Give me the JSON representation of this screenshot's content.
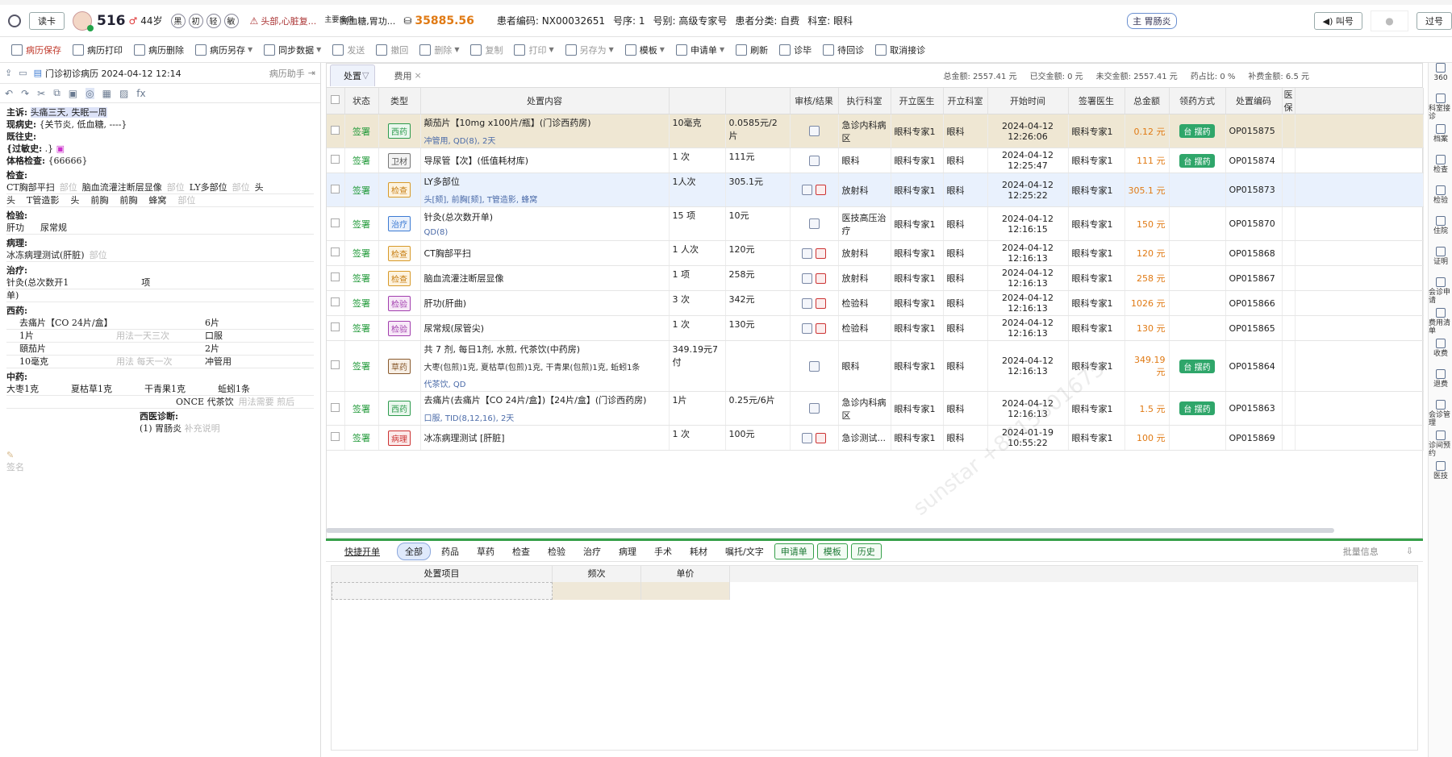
{
  "header": {
    "read_card": "读卡",
    "id_num": "516",
    "age": "44岁",
    "badges": [
      "黑",
      "初",
      "轻",
      "敏"
    ],
    "allergy": "头部,心脏复...",
    "diseases_label": "主要疾病",
    "diseases": "高血糖,胃功...",
    "balance": "35885.56",
    "patient_code": "患者编码: NX00032651",
    "seq": "号序: 1",
    "reg_type": "号别: 高级专家号",
    "category": "患者分类: 自费",
    "dept": "科室: 眼科",
    "diag_tag": "主 胃肠炎",
    "call_btn": "叫号",
    "skip_btn": "过号"
  },
  "toolbar": [
    {
      "label": "病历保存",
      "style": "red"
    },
    {
      "label": "病历打印",
      "style": ""
    },
    {
      "label": "病历删除",
      "style": ""
    },
    {
      "label": "病历另存",
      "style": "",
      "caret": true
    },
    {
      "label": "同步数据",
      "style": "",
      "caret": true
    },
    {
      "label": "发送",
      "style": "dim"
    },
    {
      "label": "撤回",
      "style": "dim"
    },
    {
      "label": "删除",
      "style": "dim",
      "caret": true
    },
    {
      "label": "复制",
      "style": "dim"
    },
    {
      "label": "打印",
      "style": "dim",
      "caret": true
    },
    {
      "label": "另存为",
      "style": "dim",
      "caret": true
    },
    {
      "label": "模板",
      "style": "",
      "caret": true
    },
    {
      "label": "申请单",
      "style": "",
      "caret": true
    },
    {
      "label": "刷新",
      "style": ""
    },
    {
      "label": "诊毕",
      "style": ""
    },
    {
      "label": "待回诊",
      "style": ""
    },
    {
      "label": "取消接诊",
      "style": ""
    }
  ],
  "emr": {
    "title": "门诊初诊病历 2024-04-12 12:14",
    "assistant": "病历助手",
    "chief_label": "主诉:",
    "chief": "头痛三天, 失眠一周",
    "present_label": "现病史:",
    "present": "{关节炎, 低血糖, ----}",
    "past_label": "既往史:",
    "allergy_label": "{过敏史:",
    "allergy_val": ".}",
    "exam_label": "体格检查:",
    "exam": "{66666}",
    "check_label": "检查:",
    "check_items": [
      "CT胸部平扫",
      "部位",
      "脑血流灌注断层显像",
      "部位",
      "LY多部位",
      "部位",
      "头"
    ],
    "check_row2": [
      "头",
      "T管造影",
      "头",
      "前胸",
      "前胸",
      "蜂窝",
      "部位"
    ],
    "lab_label": "检验:",
    "lab_items": [
      "肝功",
      "尿常规"
    ],
    "path_label": "病理:",
    "path_item": "冰冻病理测试(肝脏)",
    "path_part": "部位",
    "treat_label": "治疗:",
    "treat_item": "针灸(总次数开1",
    "treat_unit": "项",
    "treat_tail": "单)",
    "wm_label": "西药:",
    "wm_rows": [
      [
        "去痛片【CO 24片/盒】",
        "",
        "6片"
      ],
      [
        "1片",
        "用法一天三次",
        "口服"
      ],
      [
        "頤茄片",
        "",
        "2片"
      ],
      [
        "10毫克",
        "用法 每天一次",
        "冲管用"
      ]
    ],
    "cm_label": "中药:",
    "cm_items": [
      "大枣1克",
      "夏枯草1克",
      "干青果1克",
      "蚯蚓1条"
    ],
    "cm_usage": "ONCE 代茶饮",
    "cm_usage2": "用法需要 煎后",
    "diag_label": "西医诊断:",
    "diag": "(1) 胃肠炎",
    "diag_note": "补充说明",
    "sign": "签名"
  },
  "main": {
    "tabs": [
      "处置",
      "费用"
    ],
    "totals": [
      "总金额: 2557.41 元",
      "已交金额: 0 元",
      "未交金额: 2557.41 元",
      "药占比: 0 %",
      "补费金额: 6.5 元"
    ],
    "columns": [
      "状态",
      "类型",
      "处置内容",
      "",
      "",
      "审核/结果",
      "执行科室",
      "开立医生",
      "开立科室",
      "开始时间",
      "签署医生",
      "总金额",
      "领药方式",
      "处置编码",
      "医保"
    ],
    "rows": [
      {
        "status": "签署",
        "type": "西药",
        "tag": "t-xy",
        "content": "颠茄片【10mg x100片/瓶】(门诊西药房)",
        "sub": "冲管用, QD(8), 2天",
        "qty": "10毫克",
        "price": "0.0585元/2片",
        "icons": 1,
        "exec": "急诊内科病区",
        "doc": "眼科专家1",
        "dept": "眼科",
        "time": "2024-04-12 12:26:06",
        "sign": "眼科专家1",
        "amt": "0.12 元",
        "pickup": "台 摆药",
        "code": "OP015875",
        "sel": "sel"
      },
      {
        "status": "签署",
        "type": "卫材",
        "tag": "t-wc",
        "content": "导尿管【次】(低值耗材库)",
        "sub": "",
        "qty": "1 次",
        "price": "111元",
        "icons": 1,
        "exec": "眼科",
        "doc": "眼科专家1",
        "dept": "眼科",
        "time": "2024-04-12 12:25:47",
        "sign": "眼科专家1",
        "amt": "111 元",
        "pickup": "台 摆药",
        "code": "OP015874",
        "sel": ""
      },
      {
        "status": "签署",
        "type": "检查",
        "tag": "t-jc",
        "content": "LY多部位",
        "sub": "头[颏], 前胸[颏], T管造影, 蜂窝",
        "qty": "1人次",
        "price": "305.1元",
        "icons": 2,
        "exec": "放射科",
        "doc": "眼科专家1",
        "dept": "眼科",
        "time": "2024-04-12 12:25:22",
        "sign": "眼科专家1",
        "amt": "305.1 元",
        "pickup": "",
        "code": "OP015873",
        "sel": "cur"
      },
      {
        "status": "签署",
        "type": "治疗",
        "tag": "t-zl",
        "content": "针灸(总次数开单)",
        "sub": "QD(8)",
        "qty": "15 项",
        "price": "10元",
        "icons": 1,
        "exec": "医技高压治疗",
        "doc": "眼科专家1",
        "dept": "眼科",
        "time": "2024-04-12 12:16:15",
        "sign": "眼科专家1",
        "amt": "150 元",
        "pickup": "",
        "code": "OP015870",
        "sel": ""
      },
      {
        "status": "签署",
        "type": "检查",
        "tag": "t-jc",
        "content": "CT胸部平扫",
        "sub": "",
        "qty": "1 人次",
        "price": "120元",
        "icons": 2,
        "exec": "放射科",
        "doc": "眼科专家1",
        "dept": "眼科",
        "time": "2024-04-12 12:16:13",
        "sign": "眼科专家1",
        "amt": "120 元",
        "pickup": "",
        "code": "OP015868",
        "sel": ""
      },
      {
        "status": "签署",
        "type": "检查",
        "tag": "t-jc",
        "content": "脑血流灌注断层显像",
        "sub": "",
        "qty": "1 项",
        "price": "258元",
        "icons": 2,
        "exec": "放射科",
        "doc": "眼科专家1",
        "dept": "眼科",
        "time": "2024-04-12 12:16:13",
        "sign": "眼科专家1",
        "amt": "258 元",
        "pickup": "",
        "code": "OP015867",
        "sel": ""
      },
      {
        "status": "签署",
        "type": "检验",
        "tag": "t-jy",
        "content": "肝功(肝曲)",
        "sub": "",
        "qty": "3 次",
        "price": "342元",
        "icons": 2,
        "exec": "检验科",
        "doc": "眼科专家1",
        "dept": "眼科",
        "time": "2024-04-12 12:16:13",
        "sign": "眼科专家1",
        "amt": "1026 元",
        "pickup": "",
        "code": "OP015866",
        "sel": ""
      },
      {
        "status": "签署",
        "type": "检验",
        "tag": "t-jy",
        "content": "尿常规(尿管尖)",
        "sub": "",
        "qty": "1 次",
        "price": "130元",
        "icons": 2,
        "exec": "检验科",
        "doc": "眼科专家1",
        "dept": "眼科",
        "time": "2024-04-12 12:16:13",
        "sign": "眼科专家1",
        "amt": "130 元",
        "pickup": "",
        "code": "OP015865",
        "sel": ""
      },
      {
        "status": "签署",
        "type": "草药",
        "tag": "t-cy",
        "content": "共 7 剂, 每日1剂, 水煎, 代茶饮(中药房)",
        "sub": "大枣(包煎)1克, 夏枯草(包煎)1克, 干青果(包煎)1克, 蚯蚓1条",
        "sub2": "代茶饮, QD",
        "qty": "349.19元7付",
        "price": "",
        "icons": 1,
        "exec": "眼科",
        "doc": "眼科专家1",
        "dept": "眼科",
        "time": "2024-04-12 12:16:13",
        "sign": "眼科专家1",
        "amt": "349.19 元",
        "pickup": "台 摆药",
        "code": "OP015864",
        "sel": ""
      },
      {
        "status": "签署",
        "type": "西药",
        "tag": "t-xy",
        "content": "去痛片(去痛片【CO 24片/盒】)【24片/盒】(门诊西药房)",
        "sub": "口服, TID(8,12,16), 2天",
        "qty": "1片",
        "price": "0.25元/6片",
        "icons": 1,
        "exec": "急诊内科病区",
        "doc": "眼科专家1",
        "dept": "眼科",
        "time": "2024-04-12 12:16:13",
        "sign": "眼科专家1",
        "amt": "1.5 元",
        "pickup": "台 摆药",
        "code": "OP015863",
        "sel": ""
      },
      {
        "status": "签署",
        "type": "病理",
        "tag": "t-bl",
        "content": "冰冻病理测试 [肝脏]",
        "sub": "",
        "qty": "1 次",
        "price": "100元",
        "icons": 2,
        "exec": "急诊测试...",
        "doc": "眼科专家1",
        "dept": "眼科",
        "time": "2024-01-19 10:55:22",
        "sign": "眼科专家1",
        "amt": "100 元",
        "pickup": "",
        "code": "OP015869",
        "sel": ""
      }
    ]
  },
  "watermark": "sunstar +8615801675",
  "bottom": {
    "tabs": [
      "快捷开单",
      "全部",
      "药品",
      "草药",
      "检查",
      "检验",
      "治疗",
      "病理",
      "手术",
      "耗材",
      "嘱托/文字"
    ],
    "green_btns": [
      "申请单",
      "模板",
      "历史"
    ],
    "batch": "批量信息",
    "cols": [
      "处置项目",
      "频次",
      "单价"
    ]
  },
  "rail": [
    "360",
    "科室接诊",
    "档案",
    "检查",
    "检验",
    "住院",
    "证明",
    "会诊申请",
    "费用清单",
    "收费",
    "退费",
    "会诊管理",
    "诊间预约",
    "医技"
  ]
}
